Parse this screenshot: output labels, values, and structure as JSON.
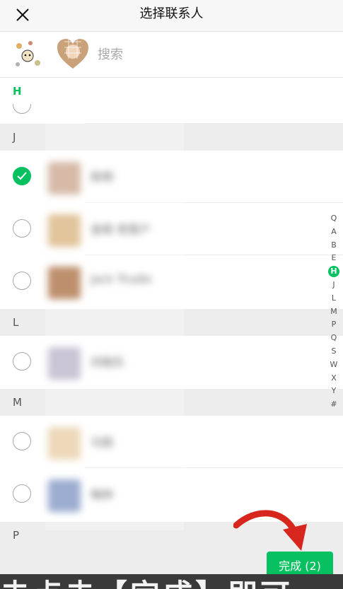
{
  "header": {
    "title": "选择联系人",
    "close_icon": "close-icon"
  },
  "search": {
    "placeholder": "搜索",
    "value": ""
  },
  "selected_avatars": [
    "sticker-avatar",
    "heart-photo-avatar"
  ],
  "sections": {
    "h": "H",
    "j": "J",
    "l": "L",
    "m": "M",
    "p": "P"
  },
  "contacts": [
    {
      "section": "J",
      "name": "陈明",
      "checked": true,
      "avatar_color": "#c9a38a"
    },
    {
      "section": "J",
      "name": "金晓 老客户",
      "checked": false,
      "avatar_color": "#d8b07a"
    },
    {
      "section": "J",
      "name": "Jack Trudie",
      "checked": false,
      "avatar_color": "#a86a3c"
    },
    {
      "section": "L",
      "name": "刘晓乐",
      "checked": false,
      "avatar_color": "#b8b0c8"
    },
    {
      "section": "M",
      "name": "马丽",
      "checked": false,
      "avatar_color": "#e8cba2"
    },
    {
      "section": "M",
      "name": "梅林",
      "checked": false,
      "avatar_color": "#7b92c0"
    }
  ],
  "index_bar": [
    "Q",
    "A",
    "B",
    "E",
    "H",
    "J",
    "L",
    "M",
    "P",
    "Q",
    "S",
    "W",
    "X",
    "Y",
    "#"
  ],
  "index_active": "H",
  "done_button": {
    "label": "完成 (2)"
  },
  "caption": "击点击【完成】即可",
  "colors": {
    "accent": "#07c160",
    "arrow": "#d7261e"
  }
}
